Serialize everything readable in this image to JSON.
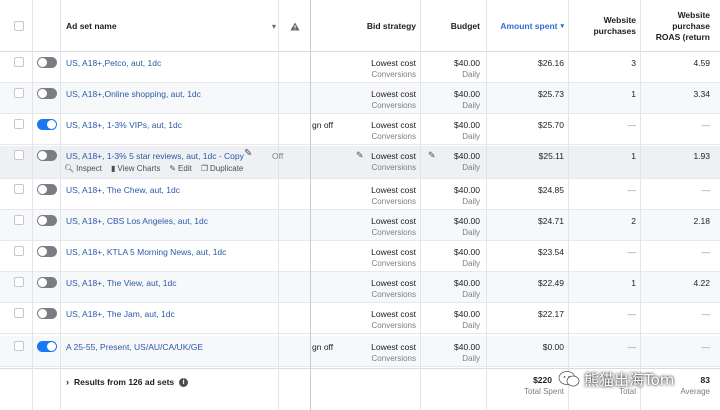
{
  "headers": {
    "ad_set_name": "Ad set name",
    "bid_strategy": "Bid strategy",
    "budget": "Budget",
    "amount_spent": "Amount spent",
    "website_purchases": [
      "Website",
      "purchases"
    ],
    "roas": [
      "Website",
      "purchase",
      "ROAS (return"
    ]
  },
  "rows": [
    {
      "name": "US, A18+,Petco, aut, 1dc",
      "toggle": "off",
      "delivery": "",
      "bid": "Lowest cost",
      "bid_sub": "Conversions",
      "budget": "$40.00",
      "budget_sub": "Daily",
      "spent": "$26.16",
      "purchases": "3",
      "roas": "4.59"
    },
    {
      "name": "US, A18+,Online shopping, aut, 1dc",
      "toggle": "off",
      "delivery": "",
      "bid": "Lowest cost",
      "bid_sub": "Conversions",
      "budget": "$40.00",
      "budget_sub": "Daily",
      "spent": "$25.73",
      "purchases": "1",
      "roas": "3.34"
    },
    {
      "name": "US, A18+, 1-3% VIPs, aut, 1dc",
      "toggle": "on",
      "delivery": "gn off",
      "bid": "Lowest cost",
      "bid_sub": "Conversions",
      "budget": "$40.00",
      "budget_sub": "Daily",
      "spent": "$25.70",
      "purchases": "—",
      "roas": "—"
    },
    {
      "name": "US, A18+, 1-3% 5 star reviews, aut, 1dc - Copy",
      "toggle": "off",
      "delivery": "Off",
      "bid": "Lowest cost",
      "bid_sub": "Conversions",
      "budget": "$40.00",
      "budget_sub": "Daily",
      "spent": "$25.11",
      "purchases": "1",
      "roas": "1.93"
    },
    {
      "name": "US, A18+, The Chew, aut, 1dc",
      "toggle": "off",
      "delivery": "",
      "bid": "Lowest cost",
      "bid_sub": "Conversions",
      "budget": "$40.00",
      "budget_sub": "Daily",
      "spent": "$24.85",
      "purchases": "—",
      "roas": "—"
    },
    {
      "name": "US, A18+, CBS Los Angeles, aut, 1dc",
      "toggle": "off",
      "delivery": "",
      "bid": "Lowest cost",
      "bid_sub": "Conversions",
      "budget": "$40.00",
      "budget_sub": "Daily",
      "spent": "$24.71",
      "purchases": "2",
      "roas": "2.18"
    },
    {
      "name": "US, A18+, KTLA 5 Morning News, aut, 1dc",
      "toggle": "off",
      "delivery": "",
      "bid": "Lowest cost",
      "bid_sub": "Conversions",
      "budget": "$40.00",
      "budget_sub": "Daily",
      "spent": "$23.54",
      "purchases": "—",
      "roas": "—"
    },
    {
      "name": "US, A18+, The View, aut, 1dc",
      "toggle": "off",
      "delivery": "",
      "bid": "Lowest cost",
      "bid_sub": "Conversions",
      "budget": "$40.00",
      "budget_sub": "Daily",
      "spent": "$22.49",
      "purchases": "1",
      "roas": "4.22"
    },
    {
      "name": "US, A18+, The Jam, aut, 1dc",
      "toggle": "off",
      "delivery": "",
      "bid": "Lowest cost",
      "bid_sub": "Conversions",
      "budget": "$40.00",
      "budget_sub": "Daily",
      "spent": "$22.17",
      "purchases": "—",
      "roas": "—"
    },
    {
      "name": "A 25-55, Present, US/AU/CA/UK/GE",
      "toggle": "on",
      "delivery": "gn off",
      "bid": "Lowest cost",
      "bid_sub": "Conversions",
      "budget": "$40.00",
      "budget_sub": "Daily",
      "spent": "$0.00",
      "purchases": "—",
      "roas": "—"
    }
  ],
  "row_actions": {
    "inspect": "Inspect",
    "view_charts": "View Charts",
    "edit": "Edit",
    "duplicate": "Duplicate"
  },
  "footer": {
    "results_label": "Results from 126 ad sets",
    "total_spent": "$220",
    "total_spent_label": "Total Spent",
    "purchases_label": "Total",
    "roas_value": "83",
    "roas_label": "Average"
  },
  "watermark": {
    "text": "熊猫出海Tom"
  },
  "colors": {
    "accent": "#1877f2",
    "link": "#2a5aa8",
    "sort_header": "#2f6fd6"
  }
}
